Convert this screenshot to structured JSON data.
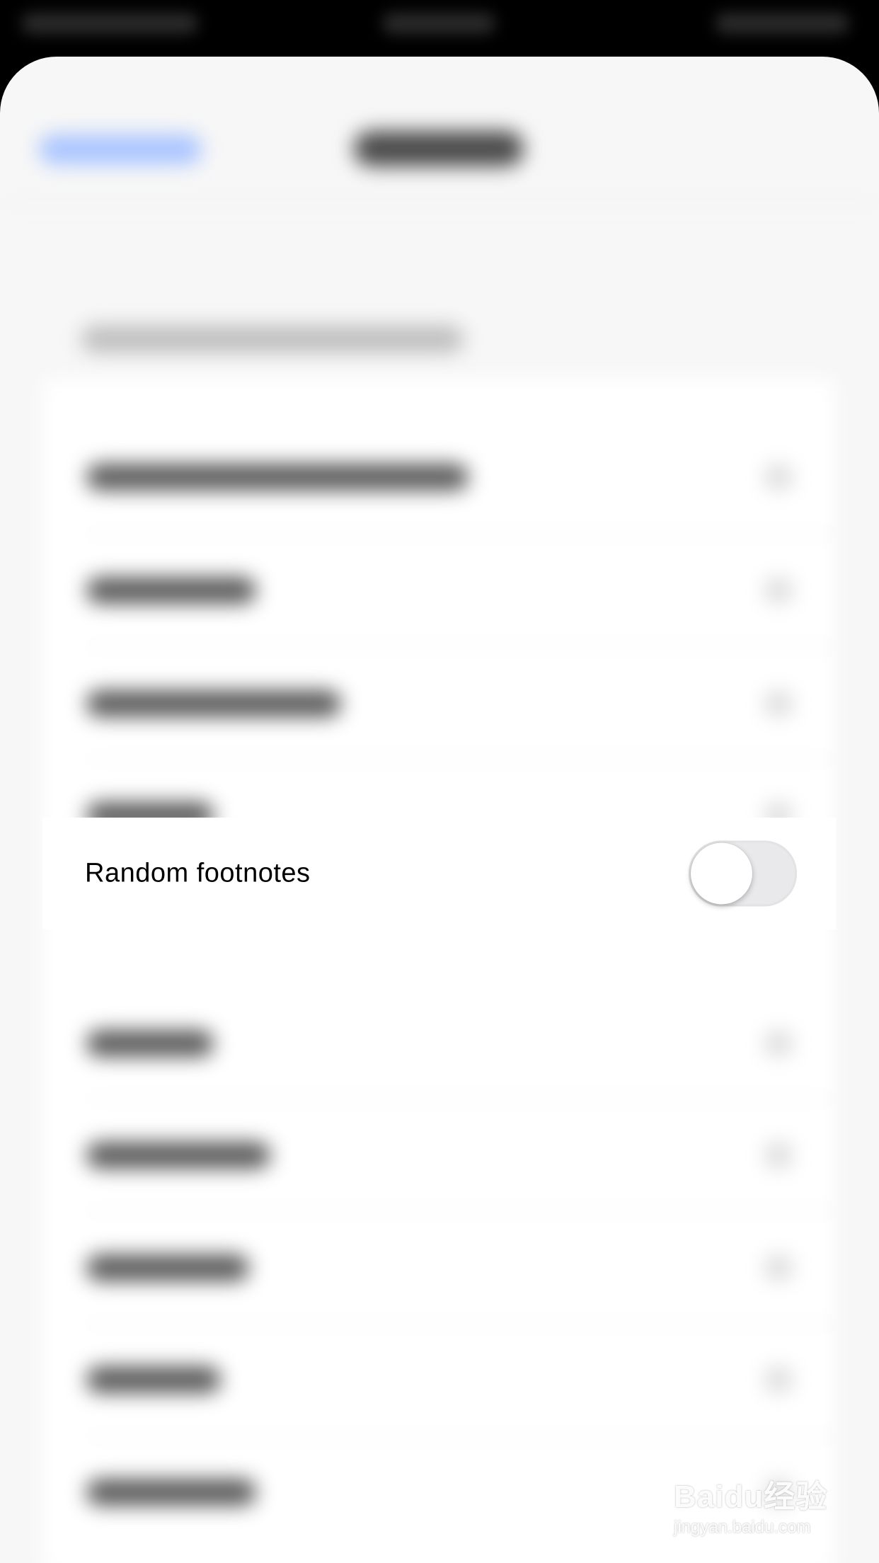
{
  "settings_row": {
    "label": "Random footnotes",
    "toggle_on": false
  },
  "watermark": {
    "logo": "Baidu经验",
    "url": "jingyan.baidu.com"
  }
}
